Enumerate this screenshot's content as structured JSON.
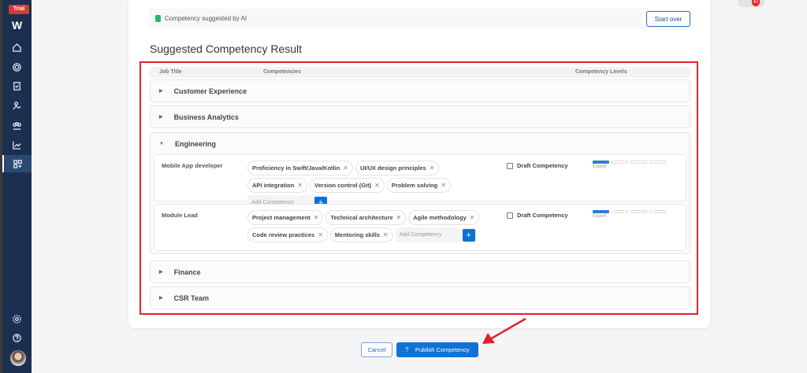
{
  "sidebar": {
    "trial_badge": "Trial",
    "logo": "W",
    "items": [
      {
        "icon": "home-icon"
      },
      {
        "icon": "target-icon"
      },
      {
        "icon": "clipboard-check-icon"
      },
      {
        "icon": "user-route-icon"
      },
      {
        "icon": "team-icon"
      },
      {
        "icon": "chart-line-icon"
      },
      {
        "icon": "apps-add-icon",
        "active": true
      }
    ],
    "bottom": [
      {
        "icon": "gear-icon"
      },
      {
        "icon": "help-icon"
      },
      {
        "icon": "avatar"
      }
    ]
  },
  "header": {
    "notification_count": "42"
  },
  "ai_bar": {
    "text": "Competency suggested by AI",
    "start_over": "Start over"
  },
  "title": "Suggested Competency Result",
  "table": {
    "headers": [
      "Job Title",
      "Competencies",
      "Competency Levels"
    ],
    "groups": [
      {
        "name": "Customer Experience",
        "expanded": false
      },
      {
        "name": "Business Analytics",
        "expanded": false
      },
      {
        "name": "Engineering",
        "expanded": true,
        "rows": [
          {
            "job_title": "Mobile App developer",
            "competencies": [
              "Proficiency in Swift/Java/Kotlin",
              "UI/UX design principles",
              "API integration",
              "Version control (Git)",
              "Problem solving"
            ],
            "add_placeholder": "Add Competency",
            "draft_label": "Draft Competency",
            "draft_checked": false,
            "level": "Expert",
            "level_filled": 1,
            "level_total": 4
          },
          {
            "job_title": "Module Lead",
            "competencies": [
              "Project management",
              "Technical architecture",
              "Agile methodology",
              "Code review practices",
              "Mentoring skills"
            ],
            "add_placeholder": "Add Competency",
            "draft_label": "Draft Competency",
            "draft_checked": false,
            "level": "Expert",
            "level_filled": 1,
            "level_total": 4
          }
        ]
      },
      {
        "name": "Finance",
        "expanded": false
      },
      {
        "name": "CSR Team",
        "expanded": false
      }
    ]
  },
  "footer": {
    "cancel": "Cancel",
    "publish": "Publish Competency"
  },
  "colors": {
    "sidebar": "#1b3050",
    "primary": "#0f72d4",
    "highlight": "#e3212b",
    "ai_icon": "#2fb36b"
  }
}
